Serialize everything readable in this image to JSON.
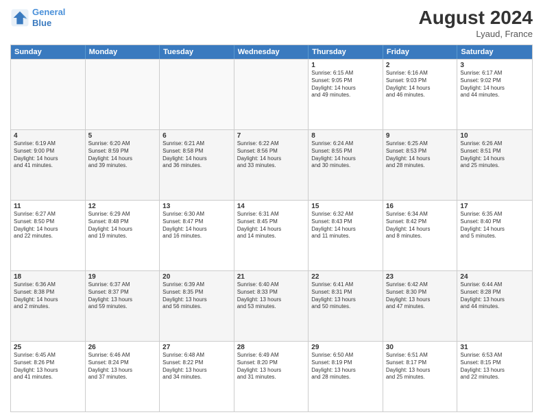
{
  "header": {
    "logo_line1": "General",
    "logo_line2": "Blue",
    "month_year": "August 2024",
    "location": "Lyaud, France"
  },
  "weekdays": [
    "Sunday",
    "Monday",
    "Tuesday",
    "Wednesday",
    "Thursday",
    "Friday",
    "Saturday"
  ],
  "rows": [
    [
      {
        "day": "",
        "text": ""
      },
      {
        "day": "",
        "text": ""
      },
      {
        "day": "",
        "text": ""
      },
      {
        "day": "",
        "text": ""
      },
      {
        "day": "1",
        "text": "Sunrise: 6:15 AM\nSunset: 9:05 PM\nDaylight: 14 hours\nand 49 minutes."
      },
      {
        "day": "2",
        "text": "Sunrise: 6:16 AM\nSunset: 9:03 PM\nDaylight: 14 hours\nand 46 minutes."
      },
      {
        "day": "3",
        "text": "Sunrise: 6:17 AM\nSunset: 9:02 PM\nDaylight: 14 hours\nand 44 minutes."
      }
    ],
    [
      {
        "day": "4",
        "text": "Sunrise: 6:19 AM\nSunset: 9:00 PM\nDaylight: 14 hours\nand 41 minutes."
      },
      {
        "day": "5",
        "text": "Sunrise: 6:20 AM\nSunset: 8:59 PM\nDaylight: 14 hours\nand 39 minutes."
      },
      {
        "day": "6",
        "text": "Sunrise: 6:21 AM\nSunset: 8:58 PM\nDaylight: 14 hours\nand 36 minutes."
      },
      {
        "day": "7",
        "text": "Sunrise: 6:22 AM\nSunset: 8:56 PM\nDaylight: 14 hours\nand 33 minutes."
      },
      {
        "day": "8",
        "text": "Sunrise: 6:24 AM\nSunset: 8:55 PM\nDaylight: 14 hours\nand 30 minutes."
      },
      {
        "day": "9",
        "text": "Sunrise: 6:25 AM\nSunset: 8:53 PM\nDaylight: 14 hours\nand 28 minutes."
      },
      {
        "day": "10",
        "text": "Sunrise: 6:26 AM\nSunset: 8:51 PM\nDaylight: 14 hours\nand 25 minutes."
      }
    ],
    [
      {
        "day": "11",
        "text": "Sunrise: 6:27 AM\nSunset: 8:50 PM\nDaylight: 14 hours\nand 22 minutes."
      },
      {
        "day": "12",
        "text": "Sunrise: 6:29 AM\nSunset: 8:48 PM\nDaylight: 14 hours\nand 19 minutes."
      },
      {
        "day": "13",
        "text": "Sunrise: 6:30 AM\nSunset: 8:47 PM\nDaylight: 14 hours\nand 16 minutes."
      },
      {
        "day": "14",
        "text": "Sunrise: 6:31 AM\nSunset: 8:45 PM\nDaylight: 14 hours\nand 14 minutes."
      },
      {
        "day": "15",
        "text": "Sunrise: 6:32 AM\nSunset: 8:43 PM\nDaylight: 14 hours\nand 11 minutes."
      },
      {
        "day": "16",
        "text": "Sunrise: 6:34 AM\nSunset: 8:42 PM\nDaylight: 14 hours\nand 8 minutes."
      },
      {
        "day": "17",
        "text": "Sunrise: 6:35 AM\nSunset: 8:40 PM\nDaylight: 14 hours\nand 5 minutes."
      }
    ],
    [
      {
        "day": "18",
        "text": "Sunrise: 6:36 AM\nSunset: 8:38 PM\nDaylight: 14 hours\nand 2 minutes."
      },
      {
        "day": "19",
        "text": "Sunrise: 6:37 AM\nSunset: 8:37 PM\nDaylight: 13 hours\nand 59 minutes."
      },
      {
        "day": "20",
        "text": "Sunrise: 6:39 AM\nSunset: 8:35 PM\nDaylight: 13 hours\nand 56 minutes."
      },
      {
        "day": "21",
        "text": "Sunrise: 6:40 AM\nSunset: 8:33 PM\nDaylight: 13 hours\nand 53 minutes."
      },
      {
        "day": "22",
        "text": "Sunrise: 6:41 AM\nSunset: 8:31 PM\nDaylight: 13 hours\nand 50 minutes."
      },
      {
        "day": "23",
        "text": "Sunrise: 6:42 AM\nSunset: 8:30 PM\nDaylight: 13 hours\nand 47 minutes."
      },
      {
        "day": "24",
        "text": "Sunrise: 6:44 AM\nSunset: 8:28 PM\nDaylight: 13 hours\nand 44 minutes."
      }
    ],
    [
      {
        "day": "25",
        "text": "Sunrise: 6:45 AM\nSunset: 8:26 PM\nDaylight: 13 hours\nand 41 minutes."
      },
      {
        "day": "26",
        "text": "Sunrise: 6:46 AM\nSunset: 8:24 PM\nDaylight: 13 hours\nand 37 minutes."
      },
      {
        "day": "27",
        "text": "Sunrise: 6:48 AM\nSunset: 8:22 PM\nDaylight: 13 hours\nand 34 minutes."
      },
      {
        "day": "28",
        "text": "Sunrise: 6:49 AM\nSunset: 8:20 PM\nDaylight: 13 hours\nand 31 minutes."
      },
      {
        "day": "29",
        "text": "Sunrise: 6:50 AM\nSunset: 8:19 PM\nDaylight: 13 hours\nand 28 minutes."
      },
      {
        "day": "30",
        "text": "Sunrise: 6:51 AM\nSunset: 8:17 PM\nDaylight: 13 hours\nand 25 minutes."
      },
      {
        "day": "31",
        "text": "Sunrise: 6:53 AM\nSunset: 8:15 PM\nDaylight: 13 hours\nand 22 minutes."
      }
    ]
  ]
}
